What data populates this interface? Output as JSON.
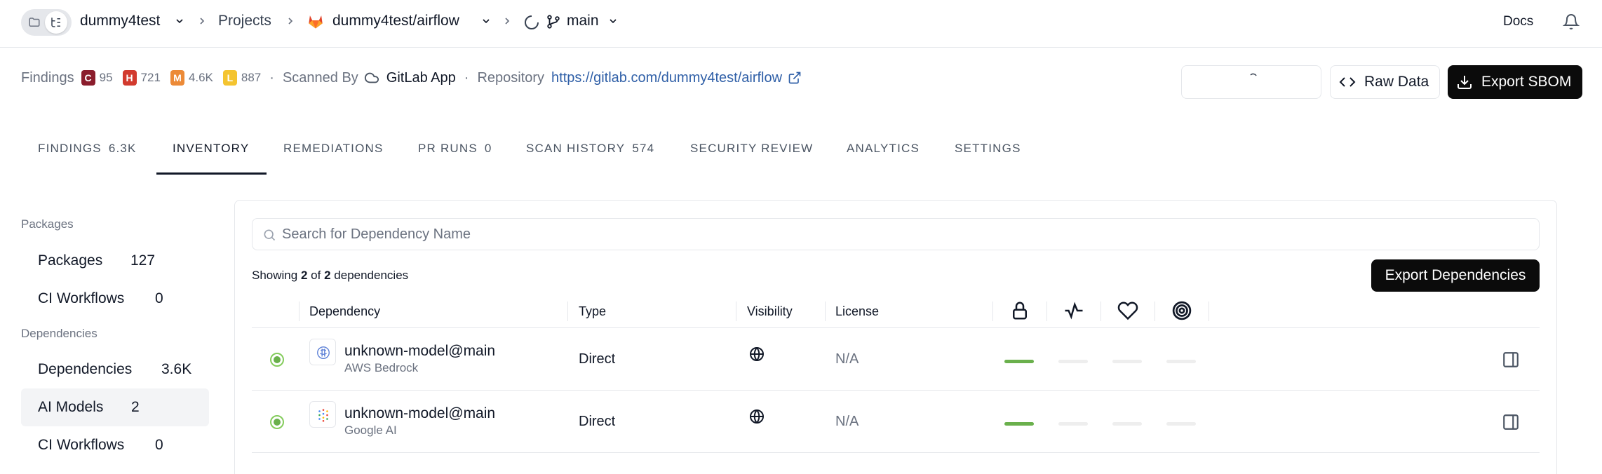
{
  "topbar": {
    "org": "dummy4test",
    "projects": "Projects",
    "repo": "dummy4test/airflow",
    "branch": "main",
    "docs": "Docs"
  },
  "summary": {
    "findings_label": "Findings",
    "severities": [
      {
        "letter": "C",
        "count": "95",
        "color": "#8b1d2c"
      },
      {
        "letter": "H",
        "count": "721",
        "color": "#d23a2e"
      },
      {
        "letter": "M",
        "count": "4.6K",
        "color": "#ec8a37"
      },
      {
        "letter": "L",
        "count": "887",
        "color": "#f4c430"
      }
    ],
    "scanned_label": "Scanned By",
    "scanned_value": "GitLab App",
    "repo_label": "Repository",
    "repo_url": "https://gitlab.com/dummy4test/airflow"
  },
  "actions": {
    "raw_data": "Raw Data",
    "export_sbom": "Export SBOM"
  },
  "tabs": [
    {
      "label": "FINDINGS",
      "count": "6.3K"
    },
    {
      "label": "INVENTORY",
      "count": ""
    },
    {
      "label": "REMEDIATIONS",
      "count": ""
    },
    {
      "label": "PR RUNS",
      "count": "0"
    },
    {
      "label": "SCAN HISTORY",
      "count": "574"
    },
    {
      "label": "SECURITY REVIEW",
      "count": ""
    },
    {
      "label": "ANALYTICS",
      "count": ""
    },
    {
      "label": "SETTINGS",
      "count": ""
    }
  ],
  "sidebar": {
    "packages_section": "Packages",
    "packages_items": [
      {
        "label": "Packages",
        "count": "127"
      },
      {
        "label": "CI Workflows",
        "count": "0"
      }
    ],
    "dependencies_section": "Dependencies",
    "dependencies_items": [
      {
        "label": "Dependencies",
        "count": "3.6K"
      },
      {
        "label": "AI Models",
        "count": "2"
      },
      {
        "label": "CI Workflows",
        "count": "0"
      }
    ]
  },
  "main": {
    "search_placeholder": "Search for Dependency Name",
    "showing_prefix": "Showing",
    "showing_count": "2",
    "showing_of": "of",
    "showing_total": "2",
    "showing_suffix": "dependencies",
    "export_dependencies": "Export Dependencies",
    "columns": [
      "Dependency",
      "Type",
      "Visibility",
      "License"
    ],
    "column_icons": [
      "lock-icon",
      "activity-icon",
      "heart-icon",
      "target-icon"
    ],
    "rows": [
      {
        "name": "unknown-model@main",
        "provider": "AWS Bedrock",
        "type": "Direct",
        "visibility_icon": "globe-icon",
        "license": "N/A",
        "scores": [
          1,
          0,
          0,
          0
        ]
      },
      {
        "name": "unknown-model@main",
        "provider": "Google AI",
        "type": "Direct",
        "visibility_icon": "globe-icon",
        "license": "N/A",
        "scores": [
          1,
          0,
          0,
          0
        ]
      }
    ]
  }
}
